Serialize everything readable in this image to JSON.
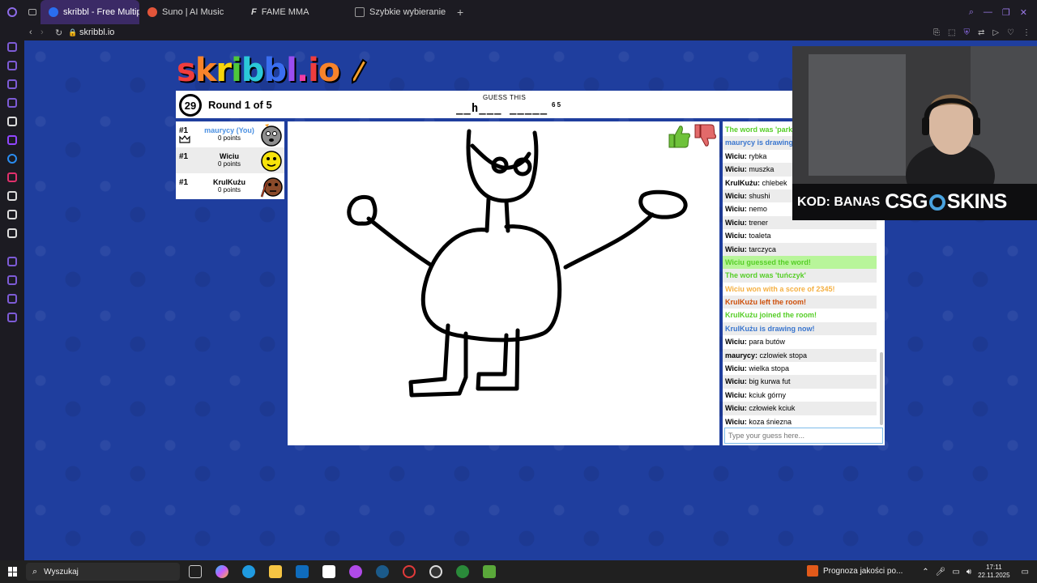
{
  "browser": {
    "tabs": [
      {
        "label": "skribbl - Free Multiplayer",
        "active": true,
        "color": "#c83a3a"
      },
      {
        "label": "Suno | AI Music",
        "active": false,
        "color": "#e2553a"
      },
      {
        "label": "FAME MMA",
        "active": false,
        "color": "#ffffff"
      },
      {
        "label": "Szybkie wybieranie",
        "active": false,
        "color": "#8e8e8e"
      }
    ],
    "url": "skribbl.io",
    "new_tab": "+"
  },
  "game": {
    "logo_letters": [
      {
        "ch": "s",
        "color": "#ef3d3d"
      },
      {
        "ch": "k",
        "color": "#f7832b"
      },
      {
        "ch": "r",
        "color": "#f6d30b"
      },
      {
        "ch": "i",
        "color": "#4ec83a"
      },
      {
        "ch": "b",
        "color": "#2bc8d8"
      },
      {
        "ch": "b",
        "color": "#3a6ef0"
      },
      {
        "ch": "l",
        "color": "#9a4ef0"
      },
      {
        "ch": ".",
        "color": "#ef3da5"
      },
      {
        "ch": "i",
        "color": "#ef3d3d"
      },
      {
        "ch": "o",
        "color": "#f7832b"
      }
    ],
    "timer": "29",
    "round": "Round 1 of 5",
    "guess_label": "GUESS THIS",
    "word_hint": "__h___ _____",
    "word_counts": "6 5",
    "players": [
      {
        "rank": "#1",
        "name": "maurycy (You)",
        "points": "0 points",
        "avatar_color": "#8e8e8e",
        "you": true
      },
      {
        "rank": "#1",
        "name": "Wiciu",
        "points": "0 points",
        "avatar_color": "#f6e30b",
        "you": false
      },
      {
        "rank": "#1",
        "name": "KrulKużu",
        "points": "0 points",
        "avatar_color": "#8a4a2a",
        "you": false
      }
    ],
    "chat": [
      {
        "type": "green",
        "text": "The word was 'parkur'"
      },
      {
        "type": "blue",
        "text": "maurycy is drawing now!"
      },
      {
        "type": "msg",
        "user": "Wiciu:",
        "text": " rybka"
      },
      {
        "type": "msg",
        "user": "Wiciu:",
        "text": " muszka"
      },
      {
        "type": "msg",
        "user": "KrulKużu:",
        "text": " chlebek"
      },
      {
        "type": "msg",
        "user": "Wiciu:",
        "text": " shushi"
      },
      {
        "type": "msg",
        "user": "Wiciu:",
        "text": " nemo"
      },
      {
        "type": "msg",
        "user": "Wiciu:",
        "text": " trener"
      },
      {
        "type": "msg",
        "user": "Wiciu:",
        "text": " toaleta"
      },
      {
        "type": "msg",
        "user": "Wiciu:",
        "text": " tarczyca"
      },
      {
        "type": "greenbg",
        "text": "Wiciu guessed the word!"
      },
      {
        "type": "green",
        "text": "The word was 'tuńczyk'"
      },
      {
        "type": "orange",
        "text": "Wiciu won with a score of 2345!"
      },
      {
        "type": "red",
        "text": "KrulKużu left the room!"
      },
      {
        "type": "green",
        "text": "KrulKużu joined the room!"
      },
      {
        "type": "blue",
        "text": "KrulKużu is drawing now!"
      },
      {
        "type": "msg",
        "user": "Wiciu:",
        "text": " para butów"
      },
      {
        "type": "msg",
        "user": "maurycy:",
        "text": " czlowiek stopa"
      },
      {
        "type": "msg",
        "user": "Wiciu:",
        "text": " wielka stopa"
      },
      {
        "type": "msg",
        "user": "Wiciu:",
        "text": " big kurwa fut"
      },
      {
        "type": "msg",
        "user": "Wiciu:",
        "text": " kciuk górny"
      },
      {
        "type": "msg",
        "user": "Wiciu:",
        "text": " człowiek kciuk"
      },
      {
        "type": "msg",
        "user": "Wiciu:",
        "text": " koza śniezna"
      }
    ],
    "chat_placeholder": "Type your guess here..."
  },
  "webcam": {
    "code": "KOD: BANAS",
    "brand_left": "CSG",
    "brand_right": "SKINS"
  },
  "taskbar": {
    "search_placeholder": "Wyszukaj",
    "weather": "Prognoza jakości po...",
    "time": "17:11",
    "date": "22.11.2025"
  }
}
